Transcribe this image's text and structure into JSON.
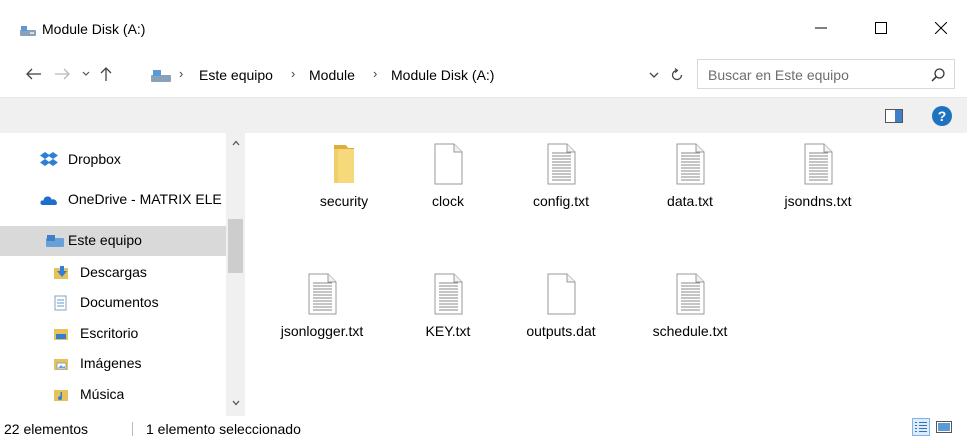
{
  "window": {
    "title": "Module Disk (A:)",
    "minimize_icon": "minimize-icon",
    "maximize_icon": "maximize-icon",
    "close_icon": "close-icon"
  },
  "address": {
    "crumbs": [
      "Este equipo",
      "Module",
      "Module Disk (A:)"
    ],
    "search_placeholder": "Buscar en Este equipo"
  },
  "nav": {
    "items": [
      {
        "label": "Dropbox",
        "icon": "dropbox-icon"
      },
      {
        "label": "OneDrive - MATRIX ELE",
        "icon": "onedrive-icon"
      },
      {
        "label": "Este equipo",
        "icon": "computer-icon",
        "selected": true
      },
      {
        "label": "Descargas",
        "icon": "downloads-folder-icon"
      },
      {
        "label": "Documentos",
        "icon": "documents-folder-icon"
      },
      {
        "label": "Escritorio",
        "icon": "desktop-folder-icon"
      },
      {
        "label": "Imágenes",
        "icon": "pictures-folder-icon"
      },
      {
        "label": "Música",
        "icon": "music-folder-icon"
      }
    ]
  },
  "files": [
    {
      "name": "security",
      "type": "folder"
    },
    {
      "name": "clock",
      "type": "blank"
    },
    {
      "name": "config.txt",
      "type": "text"
    },
    {
      "name": "data.txt",
      "type": "text"
    },
    {
      "name": "jsondns.txt",
      "type": "text"
    },
    {
      "name": "jsonlogger.txt",
      "type": "text"
    },
    {
      "name": "KEY.txt",
      "type": "text"
    },
    {
      "name": "outputs.dat",
      "type": "blank"
    },
    {
      "name": "schedule.txt",
      "type": "text"
    }
  ],
  "status": {
    "count": "22 elementos",
    "selection": "1 elemento seleccionado"
  },
  "colors": {
    "selection": "#d9d9d9",
    "accent": "#1e73be",
    "folder": "#e8c15a"
  }
}
